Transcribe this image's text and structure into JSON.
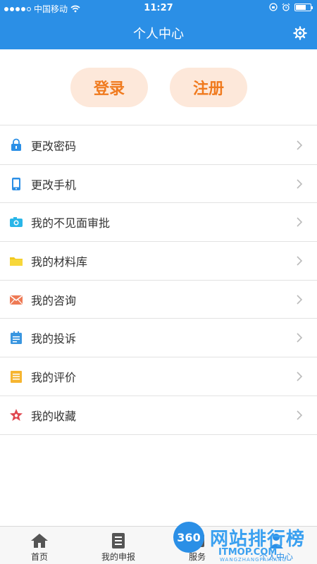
{
  "status": {
    "carrier": "中国移动",
    "time": "11:27"
  },
  "header": {
    "title": "个人中心",
    "settings_icon": "gear-icon"
  },
  "auth": {
    "login": "登录",
    "register": "注册"
  },
  "menu": {
    "items": [
      {
        "label": "更改密码",
        "icon": "lock-icon"
      },
      {
        "label": "更改手机",
        "icon": "phone-icon"
      },
      {
        "label": "我的不见面审批",
        "icon": "camera-icon"
      },
      {
        "label": "我的材料库",
        "icon": "folder-icon"
      },
      {
        "label": "我的咨询",
        "icon": "mail-icon"
      },
      {
        "label": "我的投诉",
        "icon": "clipboard-icon"
      },
      {
        "label": "我的评价",
        "icon": "document-icon"
      },
      {
        "label": "我的收藏",
        "icon": "star-icon"
      }
    ]
  },
  "tabbar": {
    "tabs": [
      {
        "label": "首页",
        "icon": "home-icon"
      },
      {
        "label": "我的申报",
        "icon": "list-icon"
      },
      {
        "label": "服务",
        "icon": "service-icon"
      },
      {
        "label": "个人中心",
        "icon": "person-icon"
      }
    ]
  },
  "watermark": {
    "badge": "360",
    "text": "网站排行榜",
    "sub": "ITMOP.COM",
    "sub2": "WANGZHANGPAIHANG"
  },
  "colors": {
    "primary": "#2b8fe6",
    "accent": "#f07a1e",
    "pill_bg": "#fde8da"
  }
}
